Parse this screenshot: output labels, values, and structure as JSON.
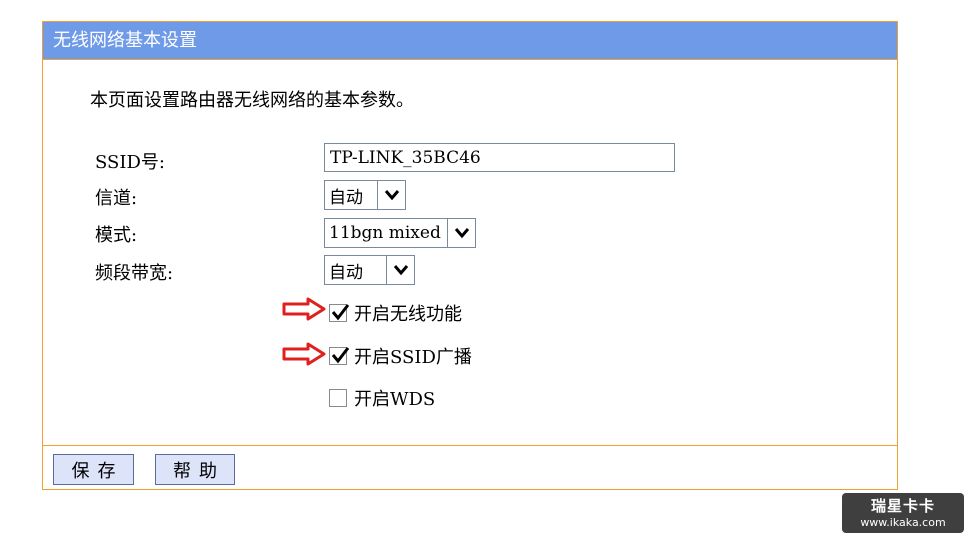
{
  "panel": {
    "title": "无线网络基本设置",
    "intro": "本页面设置路由器无线网络的基本参数。"
  },
  "form": {
    "ssid_label": "SSID号:",
    "ssid_value": "TP-LINK_35BC46",
    "channel_label": "信道:",
    "channel_value": "自动",
    "mode_label": "模式:",
    "mode_value": "11bgn mixed",
    "bandwidth_label": "频段带宽:",
    "bandwidth_value": "自动"
  },
  "checkboxes": [
    {
      "label": "开启无线功能",
      "checked": true
    },
    {
      "label": "开启SSID广播",
      "checked": true
    },
    {
      "label": "开启WDS",
      "checked": false
    }
  ],
  "buttons": {
    "save": "保存",
    "help": "帮助"
  },
  "watermark": {
    "logo": "瑞星卡卡",
    "url": "www.ikaka.com"
  },
  "colors": {
    "header_bg": "#6f9ae8",
    "border": "#f0a030",
    "button_bg": "#dde4fa",
    "arrow_red": "#e0201e"
  }
}
